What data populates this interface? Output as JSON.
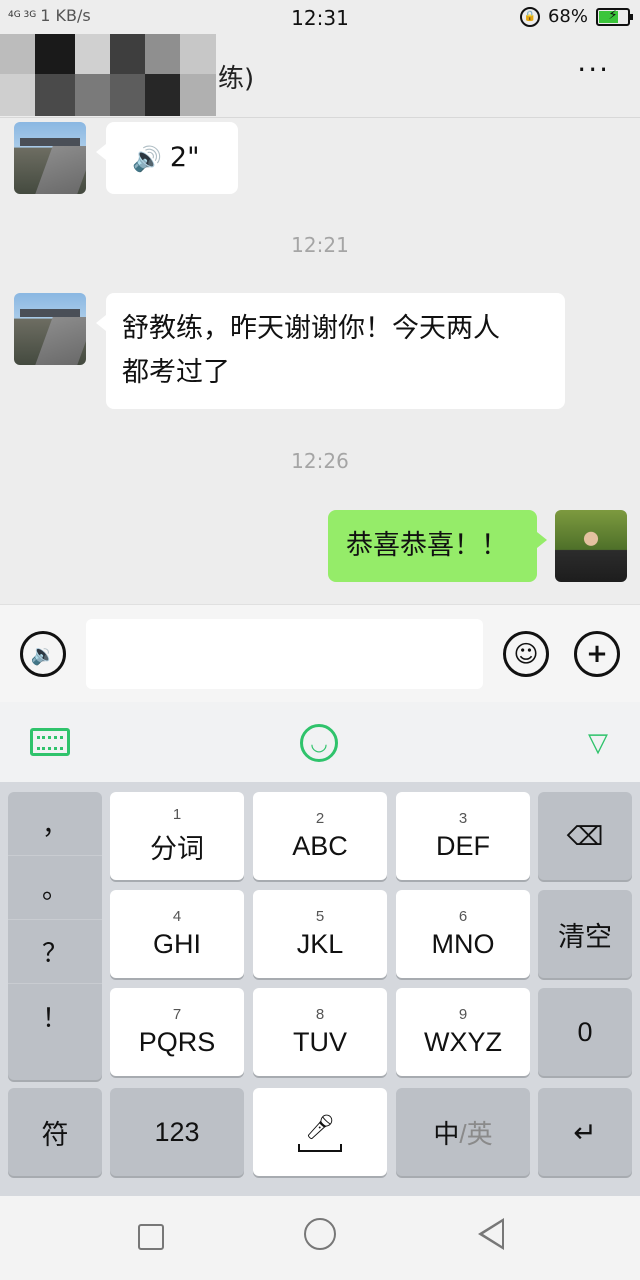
{
  "status_bar": {
    "network": "4G 3G",
    "speed": "1 KB/s",
    "time": "12:31",
    "battery": "68%",
    "battery_level": 0.68
  },
  "header": {
    "title_visible": "练)",
    "more_label": "···"
  },
  "messages": [
    {
      "type": "voice",
      "side": "left",
      "duration": "2\""
    },
    {
      "type": "timestamp",
      "text": "12:21"
    },
    {
      "type": "text",
      "side": "left",
      "line1": "舒教练，昨天谢谢你！今天两人",
      "line2": "都考过了"
    },
    {
      "type": "timestamp",
      "text": "12:26"
    },
    {
      "type": "text",
      "side": "right",
      "text": "恭喜恭喜！！"
    }
  ],
  "input_bar": {
    "text_value": ""
  },
  "keyboard": {
    "punctuation": [
      "，",
      "。",
      "？",
      "！"
    ],
    "row1": [
      {
        "num": "1",
        "label": "分词"
      },
      {
        "num": "2",
        "label": "ABC"
      },
      {
        "num": "3",
        "label": "DEF"
      }
    ],
    "row2": [
      {
        "num": "4",
        "label": "GHI"
      },
      {
        "num": "5",
        "label": "JKL"
      },
      {
        "num": "6",
        "label": "MNO"
      }
    ],
    "row3": [
      {
        "num": "7",
        "label": "PQRS"
      },
      {
        "num": "8",
        "label": "TUV"
      },
      {
        "num": "9",
        "label": "WXYZ"
      }
    ],
    "clear_label": "清空",
    "zero_label": "0",
    "symbol_label": "符",
    "numeric_label": "123",
    "zh_label": "中",
    "en_label": "/英"
  },
  "colors": {
    "accent_green": "#2fc36b",
    "own_bubble": "#95ec69",
    "background": "#ededed"
  }
}
